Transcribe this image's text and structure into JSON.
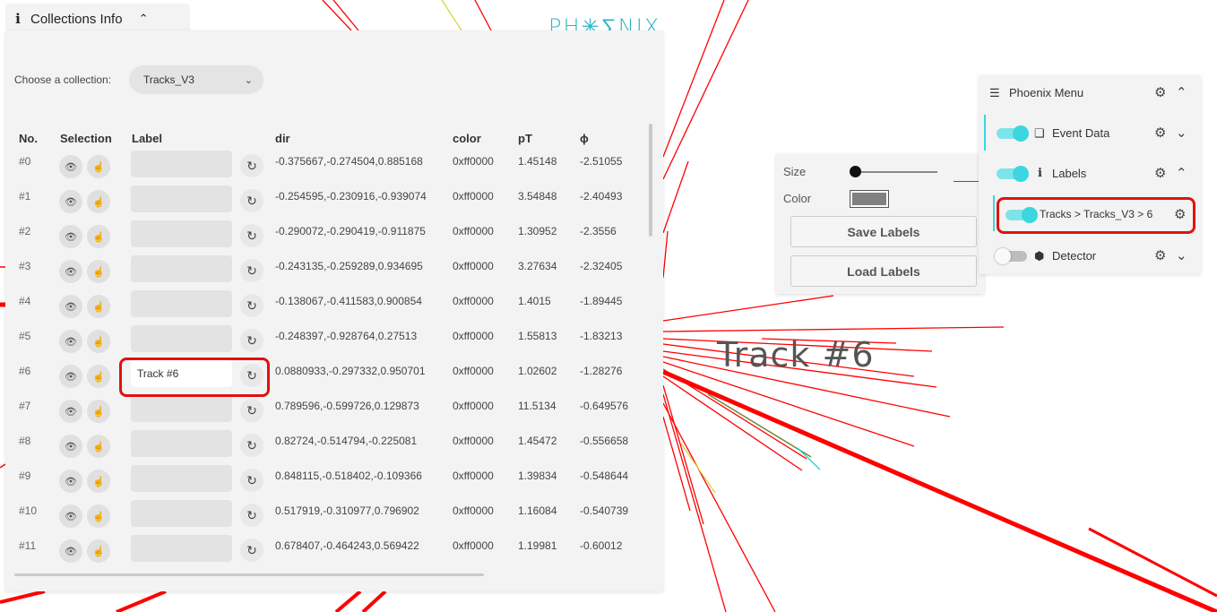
{
  "app": {
    "logo_text": "PH✳∑NIX"
  },
  "collections_panel": {
    "title": "Collections Info",
    "choose_label": "Choose a collection:",
    "selected_collection": "Tracks_V3",
    "headers": [
      "No.",
      "Selection",
      "Label",
      "dir",
      "color",
      "pT",
      "ϕ"
    ],
    "rows": [
      {
        "no": "#0",
        "label": "",
        "dir": "-0.375667,-0.274504,0.885168",
        "color": "0xff0000",
        "pT": "1.45148",
        "phi": "-2.51055"
      },
      {
        "no": "#1",
        "label": "",
        "dir": "-0.254595,-0.230916,-0.939074",
        "color": "0xff0000",
        "pT": "3.54848",
        "phi": "-2.40493"
      },
      {
        "no": "#2",
        "label": "",
        "dir": "-0.290072,-0.290419,-0.911875",
        "color": "0xff0000",
        "pT": "1.30952",
        "phi": "-2.3556"
      },
      {
        "no": "#3",
        "label": "",
        "dir": "-0.243135,-0.259289,0.934695",
        "color": "0xff0000",
        "pT": "3.27634",
        "phi": "-2.32405"
      },
      {
        "no": "#4",
        "label": "",
        "dir": "-0.138067,-0.411583,0.900854",
        "color": "0xff0000",
        "pT": "1.4015",
        "phi": "-1.89445"
      },
      {
        "no": "#5",
        "label": "",
        "dir": "-0.248397,-0.928764,0.27513",
        "color": "0xff0000",
        "pT": "1.55813",
        "phi": "-1.83213"
      },
      {
        "no": "#6",
        "label": "Track #6",
        "dir": "0.0880933,-0.297332,0.950701",
        "color": "0xff0000",
        "pT": "1.02602",
        "phi": "-1.28276"
      },
      {
        "no": "#7",
        "label": "",
        "dir": "0.789596,-0.599726,0.129873",
        "color": "0xff0000",
        "pT": "11.5134",
        "phi": "-0.649576"
      },
      {
        "no": "#8",
        "label": "",
        "dir": "0.82724,-0.514794,-0.225081",
        "color": "0xff0000",
        "pT": "1.45472",
        "phi": "-0.556658"
      },
      {
        "no": "#9",
        "label": "",
        "dir": "0.848115,-0.518402,-0.109366",
        "color": "0xff0000",
        "pT": "1.39834",
        "phi": "-0.548644"
      },
      {
        "no": "#10",
        "label": "",
        "dir": "0.517919,-0.310977,0.796902",
        "color": "0xff0000",
        "pT": "1.16084",
        "phi": "-0.540739"
      },
      {
        "no": "#11",
        "label": "",
        "dir": "0.678407,-0.464243,0.569422",
        "color": "0xff0000",
        "pT": "1.19981",
        "phi": "-0.60012"
      }
    ]
  },
  "scene": {
    "track_label": "Track #6",
    "track_color": "#ff0000",
    "accent": "#3bd6e0"
  },
  "label_options": {
    "size_label": "Size",
    "color_label": "Color",
    "swatch_color": "#808080",
    "save_label": "Save Labels",
    "load_label": "Load Labels"
  },
  "phoenix_menu": {
    "title": "Phoenix Menu",
    "items": [
      {
        "label": "Event Data",
        "icon": "event-data-icon",
        "on": true
      },
      {
        "label": "Labels",
        "icon": "info-icon",
        "on": true
      },
      {
        "label": "Tracks > Tracks_V3 > 6",
        "icon": "",
        "on": true
      },
      {
        "label": "Detector",
        "icon": "cube-icon",
        "on": false
      }
    ]
  }
}
